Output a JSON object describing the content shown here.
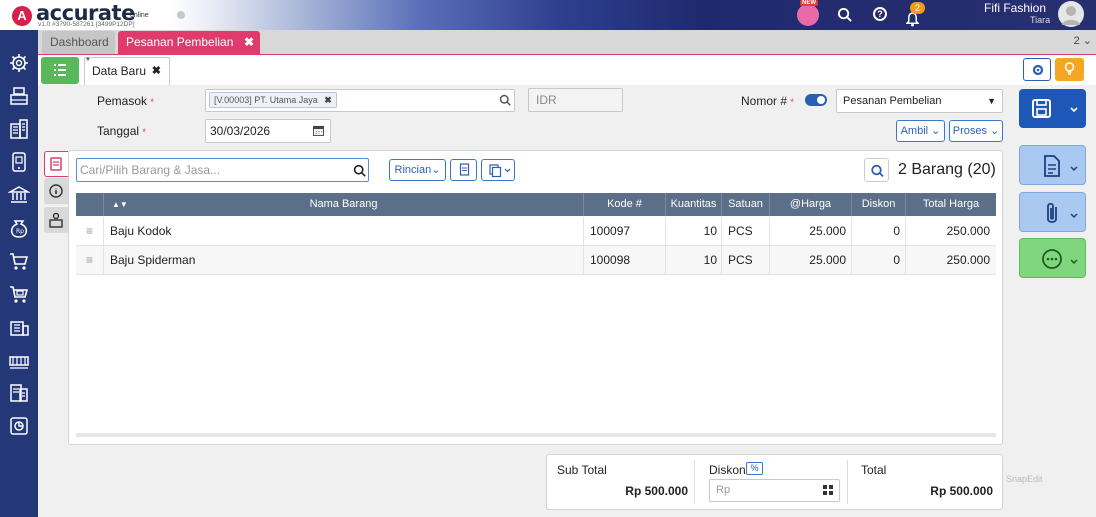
{
  "app": {
    "logo_letter": "A",
    "logo_text": "accurate",
    "logo_online": "online",
    "version": "v1.0 #3790-587261 [3499P12DP]",
    "notif_count": "2",
    "new_badge": "NEW",
    "user_name": "Fifi Fashion",
    "user_sub": "Tiara"
  },
  "tabs": {
    "dashboard": "Dashboard",
    "active": "Pesanan Pembelian",
    "close": "✖",
    "count": "2 ⌄"
  },
  "subtab": {
    "star": "*",
    "label": "Data Baru",
    "close": "✖"
  },
  "form": {
    "pemasok_label": "Pemasok",
    "pemasok_value": "[V.00003] PT. Utama Jaya",
    "currency": "IDR",
    "tanggal_label": "Tanggal",
    "tanggal_value": "30/03/2026",
    "required_mark": "*",
    "nomor_label": "Nomor #",
    "nomor_select": "Pesanan Pembelian",
    "ambil_label": "Ambil",
    "proses_label": "Proses"
  },
  "items": {
    "search_placeholder": "Cari/Pilih Barang & Jasa...",
    "rincian_label": "Rincian",
    "count_label": "2 Barang (20)",
    "columns": {
      "nama": "Nama Barang",
      "kode": "Kode #",
      "qty": "Kuantitas",
      "satuan": "Satuan",
      "harga": "@Harga",
      "diskon": "Diskon",
      "total": "Total Harga"
    },
    "rows": [
      {
        "nama": "Baju Kodok",
        "kode": "100097",
        "qty": "10",
        "satuan": "PCS",
        "harga": "25.000",
        "diskon": "0",
        "total": "250.000"
      },
      {
        "nama": "Baju Spiderman",
        "kode": "100098",
        "qty": "10",
        "satuan": "PCS",
        "harga": "25.000",
        "diskon": "0",
        "total": "250.000"
      }
    ]
  },
  "totals": {
    "subtotal_label": "Sub Total",
    "subtotal_value": "Rp 500.000",
    "diskon_label": "Diskon",
    "diskon_pct": "%",
    "diskon_placeholder": "Rp",
    "total_label": "Total",
    "total_value": "Rp 500.000"
  },
  "watermark": "SnapEdit",
  "colors": {
    "brand_pink": "#e13a6d",
    "nav_blue": "#243777",
    "header_slate": "#5c6f89",
    "save_blue": "#1d57b8",
    "green": "#5ab85c"
  }
}
